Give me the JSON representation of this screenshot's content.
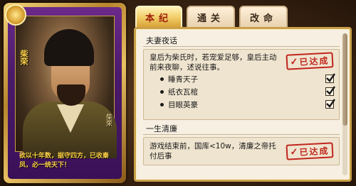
{
  "tabs": [
    {
      "label": "本纪",
      "active": true
    },
    {
      "label": "通关",
      "active": false
    },
    {
      "label": "改命",
      "active": false
    }
  ],
  "card": {
    "name": "柴荣",
    "seal": "柴荣",
    "quote": "欲以十年数，据守四方，已收秦凤，必一统天下！"
  },
  "panel": {
    "quests": [
      {
        "title": "夫妻夜话",
        "description": "皇后为柴氏时，若宠爱足够，皇后主动前来夜聊，述说往事。",
        "status": "已达成",
        "sub_items": [
          {
            "label": "睡青天子",
            "checked": true
          },
          {
            "label": "纸衣瓦棺",
            "checked": true
          },
          {
            "label": "目眼英豪",
            "checked": true
          }
        ]
      },
      {
        "title": "一生清廉",
        "description": "游戏结束前，国库<10w，清廉之帝托付后事",
        "status": "已达成",
        "sub_items": []
      }
    ]
  },
  "colors": {
    "stamp": "#c0261e",
    "tab_active_text": "#a0200c",
    "panel_border": "#c9a04a"
  }
}
